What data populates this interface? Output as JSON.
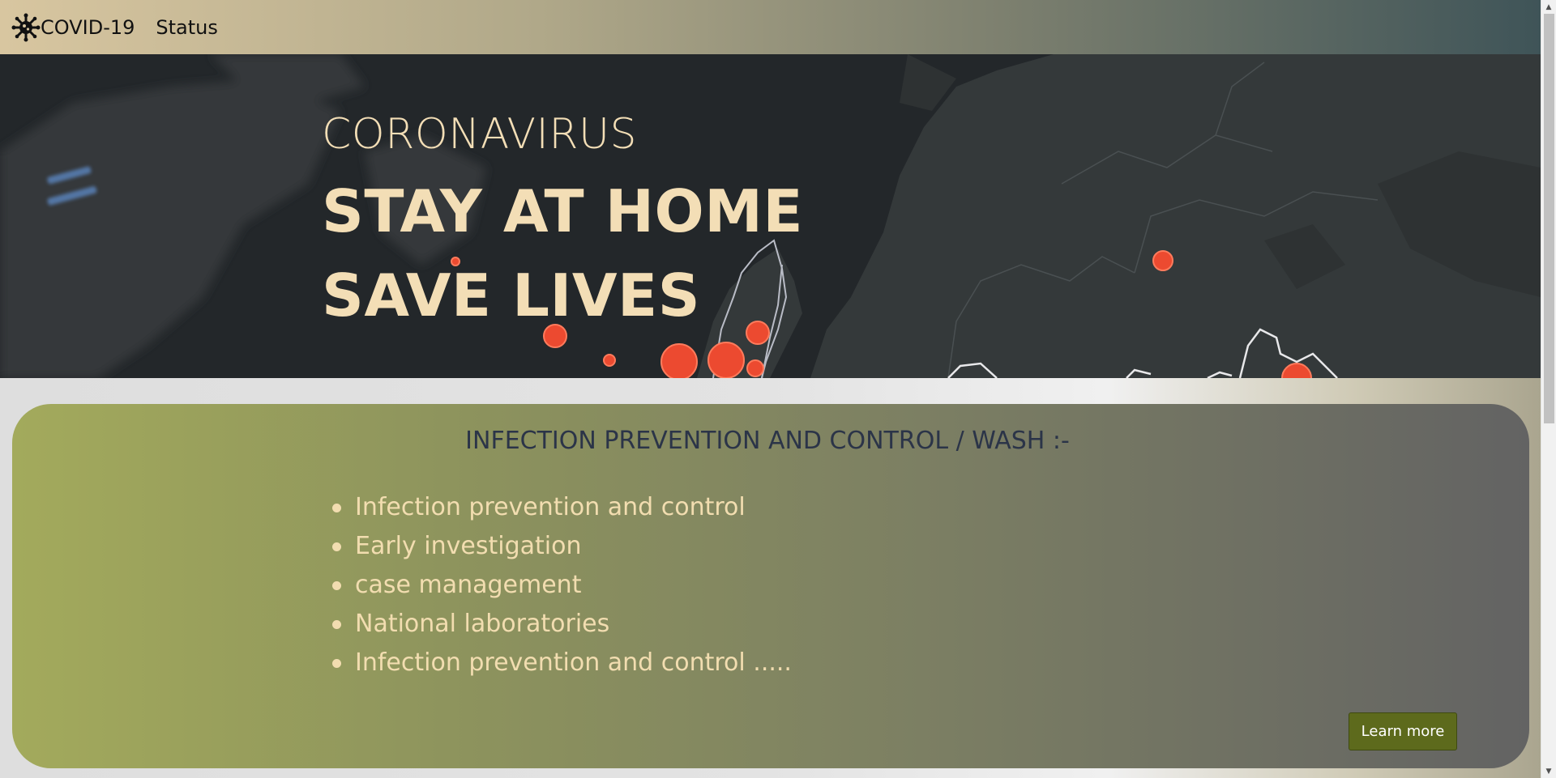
{
  "navbar": {
    "brand_icon": "virus-icon",
    "brand_label": "COVID-19",
    "status_link": "Status"
  },
  "hero": {
    "subtitle": "CORONAVIRUS",
    "line1": "STAY AT HOME",
    "line2": "SAVE LIVES"
  },
  "card": {
    "title": "INFECTION PREVENTION AND CONTROL / WASH :-",
    "items": [
      "Infection prevention and control",
      "Early investigation",
      "case management",
      "National laboratories",
      "Infection prevention and control ....."
    ],
    "button_label": "Learn more"
  },
  "colors": {
    "hero_text": "#f3deb6",
    "card_title": "#2b3448",
    "list_text": "#f2ddb0",
    "button_bg": "#5d6a1c"
  }
}
